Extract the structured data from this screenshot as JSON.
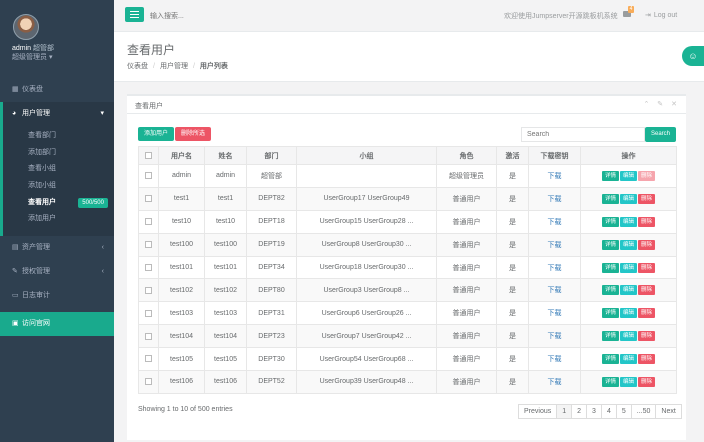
{
  "profile": {
    "username": "admin",
    "title": "超管部",
    "role": "超级管理员",
    "caret": "▾"
  },
  "sidebar": {
    "items": [
      {
        "label": "仪表盘",
        "icon": "dashboard-icon",
        "glyph": "▦"
      },
      {
        "label": "用户管理",
        "icon": "users-icon",
        "glyph": "◕",
        "arrow": "▾"
      },
      {
        "label": "资产管理",
        "icon": "server-icon",
        "glyph": "▤",
        "arrow": "‹"
      },
      {
        "label": "授权管理",
        "icon": "edit-icon",
        "glyph": "✎",
        "arrow": "‹"
      },
      {
        "label": "日志审计",
        "icon": "log-icon",
        "glyph": "▭"
      },
      {
        "label": "访问官网",
        "icon": "website-icon",
        "glyph": "▣"
      }
    ],
    "submenu": [
      {
        "label": "查看部门"
      },
      {
        "label": "添加部门"
      },
      {
        "label": "查看小组"
      },
      {
        "label": "添加小组"
      },
      {
        "label": "查看用户",
        "badge": "500/500"
      },
      {
        "label": "添加用户"
      }
    ]
  },
  "topbar": {
    "search_placeholder": "输入搜索...",
    "welcome": "欢迎使用Jumpserver开源跳板机系统",
    "mail_count": "4",
    "logout": "Log out",
    "logout_glyph": "⇥"
  },
  "heading": {
    "title": "查看用户",
    "breadcrumb": [
      "仪表盘",
      "用户管理",
      "用户列表"
    ],
    "separator": "/"
  },
  "panel": {
    "title": "查看用户",
    "tools": "⌃ ✎ ✕",
    "add_label": "添加用户",
    "delete_label": "删除所选",
    "search_placeholder": "Search",
    "search_button": "Search"
  },
  "table": {
    "columns": [
      "",
      "用户名",
      "姓名",
      "部门",
      "小组",
      "角色",
      "激活",
      "下载密钥",
      "操作"
    ],
    "rows": [
      [
        "admin",
        "admin",
        "超管部",
        "",
        "超级管理员",
        "是",
        "下载"
      ],
      [
        "test1",
        "test1",
        "DEPT82",
        "UserGroup17 UserGroup49",
        "普通用户",
        "是",
        "下载"
      ],
      [
        "test10",
        "test10",
        "DEPT18",
        "UserGroup15 UserGroup28 ...",
        "普通用户",
        "是",
        "下载"
      ],
      [
        "test100",
        "test100",
        "DEPT19",
        "UserGroup8 UserGroup30 ...",
        "普通用户",
        "是",
        "下载"
      ],
      [
        "test101",
        "test101",
        "DEPT34",
        "UserGroup18 UserGroup30 ...",
        "普通用户",
        "是",
        "下载"
      ],
      [
        "test102",
        "test102",
        "DEPT80",
        "UserGroup3 UserGroup8 ...",
        "普通用户",
        "是",
        "下载"
      ],
      [
        "test103",
        "test103",
        "DEPT31",
        "UserGroup6 UserGroup26 ...",
        "普通用户",
        "是",
        "下载"
      ],
      [
        "test104",
        "test104",
        "DEPT23",
        "UserGroup7 UserGroup42 ...",
        "普通用户",
        "是",
        "下载"
      ],
      [
        "test105",
        "test105",
        "DEPT30",
        "UserGroup54 UserGroup68 ...",
        "普通用户",
        "是",
        "下载"
      ],
      [
        "test106",
        "test106",
        "DEPT52",
        "UserGroup39 UserGroup48 ...",
        "普通用户",
        "是",
        "下载"
      ]
    ],
    "actions": [
      "详情",
      "编辑",
      "删除"
    ]
  },
  "footer": {
    "info": "Showing 1 to 10 of 500 entries",
    "pages": [
      "Previous",
      "1",
      "2",
      "3",
      "4",
      "5",
      "...50",
      "Next"
    ]
  },
  "colors": {
    "accent": "#1ab394",
    "danger": "#ed5565",
    "sidebar": "#2f4050",
    "info": "#23c6c8"
  }
}
